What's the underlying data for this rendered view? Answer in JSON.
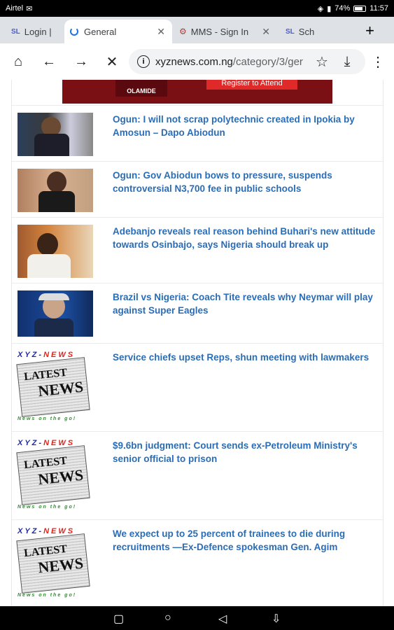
{
  "status_bar": {
    "carrier": "Airtel",
    "battery": "74%",
    "time": "11:57"
  },
  "tabs": [
    {
      "icon": "SL",
      "label": "Login |"
    },
    {
      "label": "General"
    },
    {
      "label": "MMS - Sign In"
    },
    {
      "icon": "SL",
      "label": "Sch"
    }
  ],
  "toolbar": {
    "url_domain": "xyznews.com.ng",
    "url_path": "/category/3/ger"
  },
  "banner": {
    "left_text": "OLAMIDE",
    "right_text": "Register to Attend"
  },
  "articles": [
    {
      "headline": "Ogun: I will not scrap polytechnic created in Ipokia by Amosun – Dapo Abiodun"
    },
    {
      "headline": "Ogun: Gov Abiodun bows to pressure, suspends controversial N3,700 fee in public schools"
    },
    {
      "headline": "Adebanjo reveals real reason behind Buhari's new attitude towards Osinbajo, says Nigeria should break up"
    },
    {
      "headline": "Brazil vs Nigeria: Coach Tite reveals why Neymar will play against Super Eagles"
    },
    {
      "headline": "Service chiefs upset Reps, shun meeting with lawmakers"
    },
    {
      "headline": "$9.6bn judgment: Court sends ex-Petroleum Ministry's senior official to prison"
    },
    {
      "headline": "We expect up to 25 percent of trainees to die during recruitments —Ex-Defence spokesman Gen. Agim"
    }
  ],
  "xyz_logo": {
    "part1": "XYZ-",
    "part2": "NEWS",
    "latest": "LATEST",
    "news": "NEWS",
    "tagline": "News on the go!"
  },
  "colors": {
    "headline": "#2a6db6",
    "banner": "#7a0f14"
  }
}
